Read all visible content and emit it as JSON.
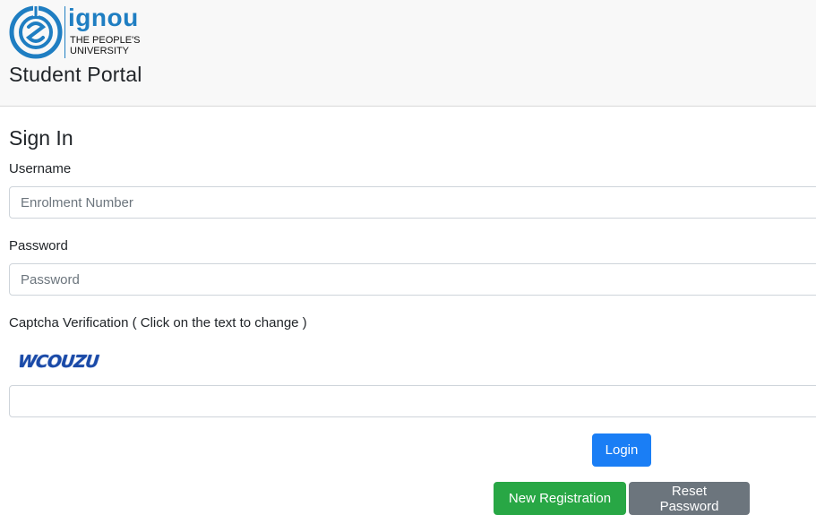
{
  "header": {
    "logo": {
      "wordmark": "ignou",
      "tagline_line1": "THE PEOPLE'S",
      "tagline_line2": "UNIVERSITY",
      "icon": "ignou-emblem-icon",
      "color": "#1f7ec2"
    },
    "portal_title": "Student Portal"
  },
  "signin": {
    "heading": "Sign In",
    "username": {
      "label": "Username",
      "value": "",
      "placeholder": "Enrolment Number"
    },
    "password": {
      "label": "Password",
      "value": "",
      "placeholder": "Password"
    },
    "captcha": {
      "label": "Captcha Verification ( Click on the text to change )",
      "text": "WCOUZU",
      "value": "",
      "placeholder": ""
    },
    "buttons": {
      "login": "Login",
      "new_registration": "New Registration",
      "reset_password": "Reset Password"
    }
  },
  "colors": {
    "primary": "#1a7ef5",
    "success": "#28a745",
    "secondary": "#6c757d",
    "header_bg": "#f8f8f8"
  }
}
